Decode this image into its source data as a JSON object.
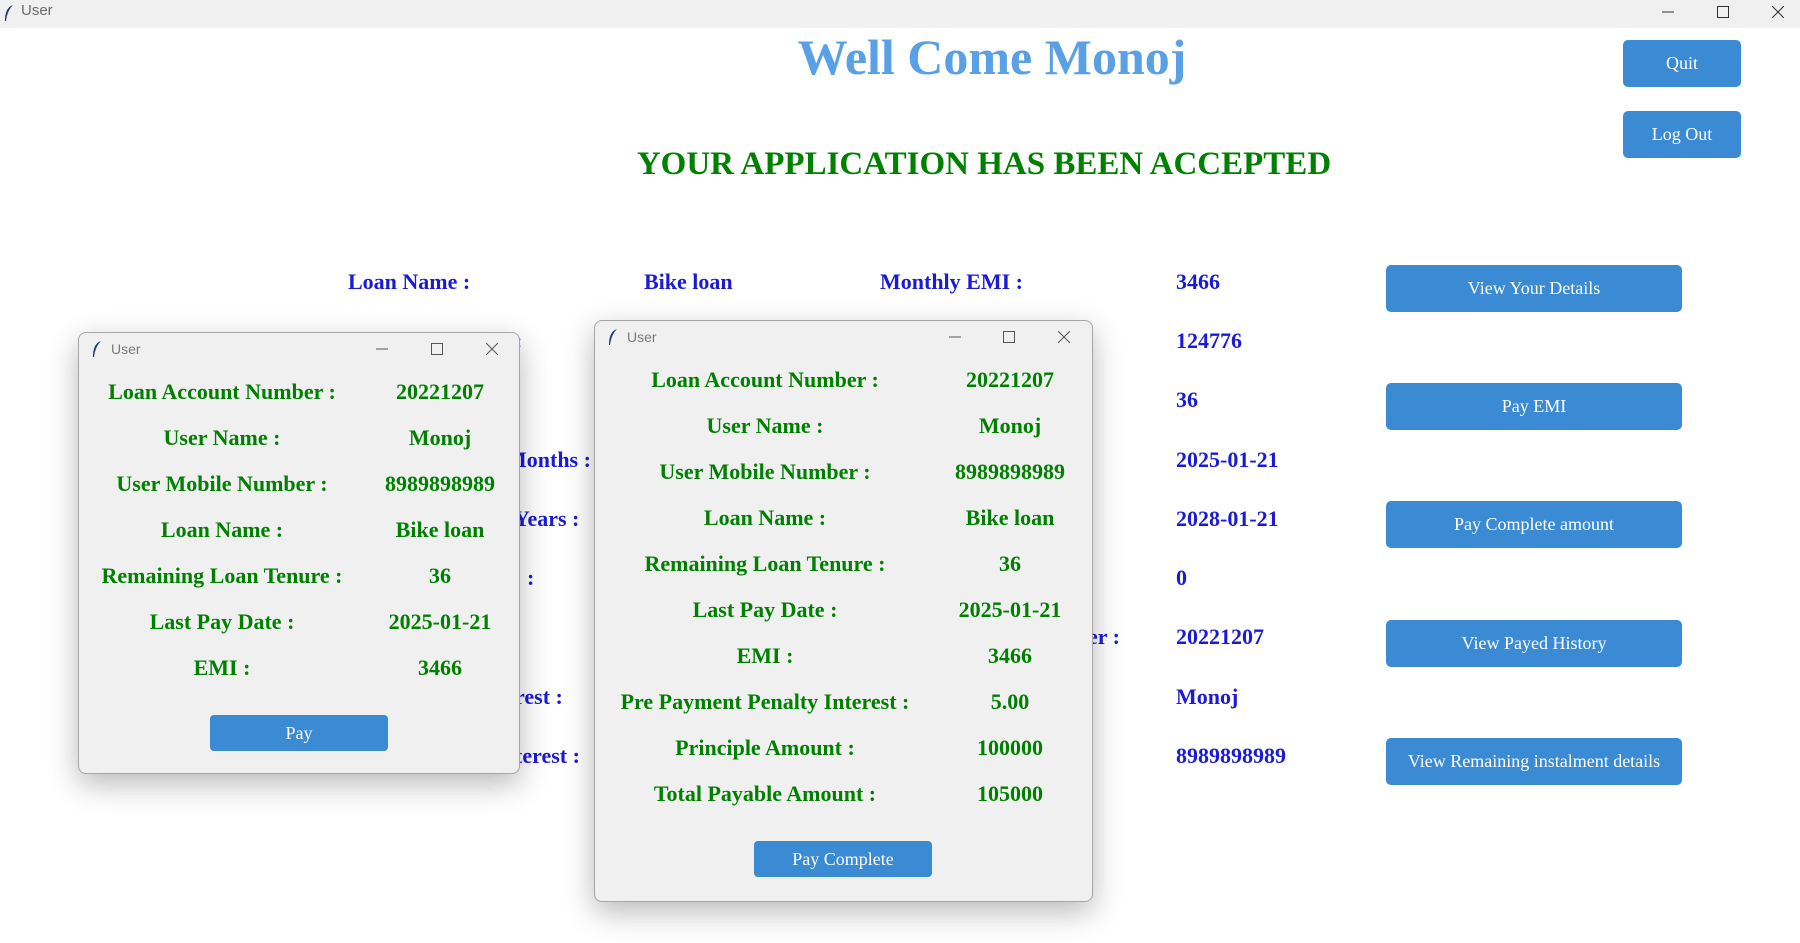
{
  "window": {
    "title": "User"
  },
  "header": {
    "welcome": "Well Come Monoj",
    "status": "YOUR APPLICATION HAS BEEN ACCEPTED"
  },
  "top_buttons": {
    "quit": "Quit",
    "logout": "Log Out"
  },
  "details": {
    "loan_name_label": "Loan Name :",
    "loan_name_value": "Bike loan",
    "monthly_emi_label": "Monthly EMI :",
    "partial_labels": [
      ":",
      "Months :",
      "Years :",
      ":",
      "er :",
      "rest :",
      "terest :"
    ],
    "values": [
      "3466",
      "124776",
      "36",
      "2025-01-21",
      "2028-01-21",
      "0",
      "20221207",
      "Monoj",
      "8989898989"
    ]
  },
  "side_buttons": {
    "view_details": "View Your Details",
    "pay_emi": "Pay EMI",
    "pay_complete": "Pay Complete amount",
    "view_history": "View Payed History",
    "view_remaining": "View Remaining instalment details"
  },
  "popup_emi": {
    "title": "User",
    "rows": [
      {
        "label": "Loan Account Number :",
        "value": "20221207"
      },
      {
        "label": "User Name :",
        "value": "Monoj"
      },
      {
        "label": "User Mobile Number :",
        "value": "8989898989"
      },
      {
        "label": "Loan Name :",
        "value": "Bike loan"
      },
      {
        "label": "Remaining Loan Tenure :",
        "value": "36"
      },
      {
        "label": "Last Pay Date :",
        "value": "2025-01-21"
      },
      {
        "label": "EMI :",
        "value": "3466"
      }
    ],
    "button": "Pay"
  },
  "popup_complete": {
    "title": "User",
    "rows": [
      {
        "label": "Loan Account Number :",
        "value": "20221207"
      },
      {
        "label": "User Name :",
        "value": "Monoj"
      },
      {
        "label": "User Mobile Number :",
        "value": "8989898989"
      },
      {
        "label": "Loan Name :",
        "value": "Bike loan"
      },
      {
        "label": "Remaining Loan Tenure :",
        "value": "36"
      },
      {
        "label": "Last Pay Date :",
        "value": "2025-01-21"
      },
      {
        "label": "EMI :",
        "value": "3466"
      },
      {
        "label": "Pre Payment Penalty Interest :",
        "value": "5.00"
      },
      {
        "label": "Principle Amount :",
        "value": "100000"
      },
      {
        "label": "Total Payable Amount :",
        "value": "105000"
      }
    ],
    "button": "Pay Complete"
  },
  "colors": {
    "heading_blue": "#5aa0e4",
    "accent_green": "#008000",
    "text_blue": "#1a1ad8",
    "button_blue": "#3a8ad4"
  }
}
